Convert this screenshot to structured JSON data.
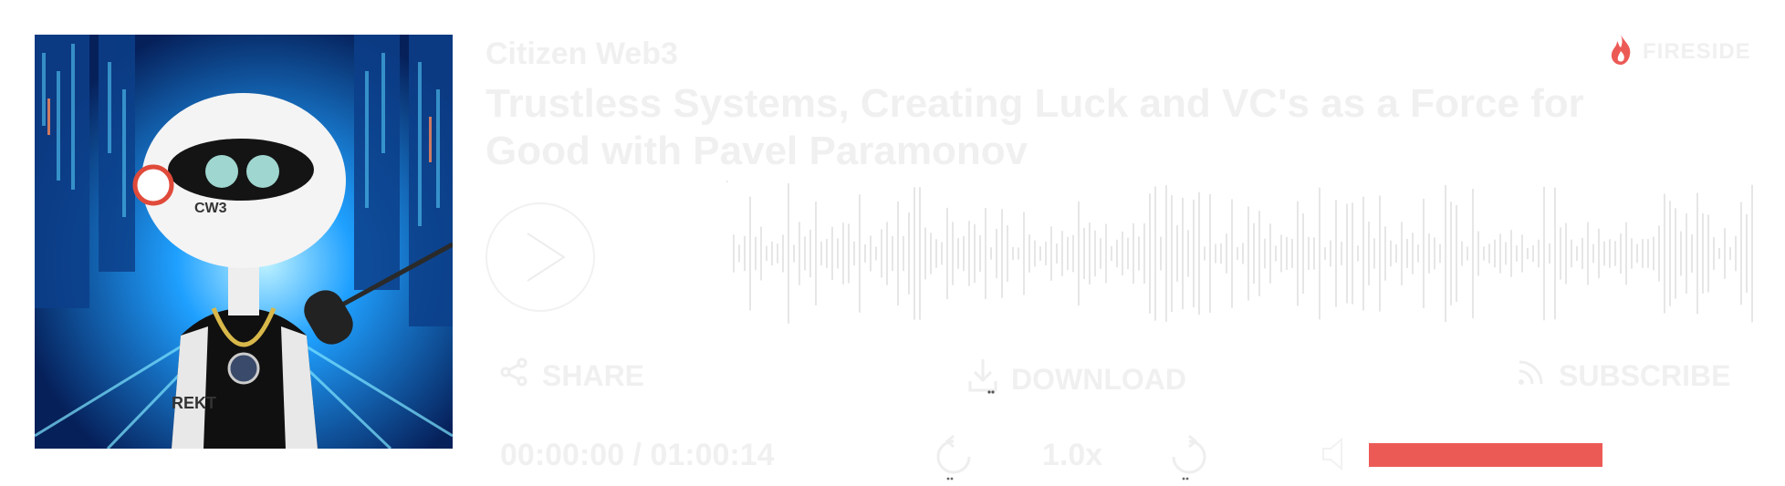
{
  "podcast": {
    "name": "Citizen Web3"
  },
  "brand": {
    "name": "FIRESIDE",
    "color": "#ec5a56"
  },
  "episode": {
    "title": "Trustless Systems, Creating Luck and VC's as a Force for Good with Pavel Paramonov"
  },
  "player": {
    "time": "00:00:00 / 01:00:14",
    "speed": "1.0x",
    "volume_percent": 100,
    "accent_color": "#ec5a56"
  },
  "actions": {
    "share": "SHARE",
    "download": "DOWNLOAD",
    "subscribe": "SUBSCRIBE"
  },
  "cover": {
    "helmet_text": "CW3",
    "tattoo_text": "REKT",
    "alt": "Citizen Web3 cover art"
  },
  "icons": {
    "play": "play-icon",
    "share": "share-icon",
    "download": "download-icon",
    "subscribe": "rss-icon",
    "rewind": "rewind-15-icon",
    "forward": "forward-15-icon",
    "volume": "volume-icon",
    "brand": "flame-icon"
  }
}
